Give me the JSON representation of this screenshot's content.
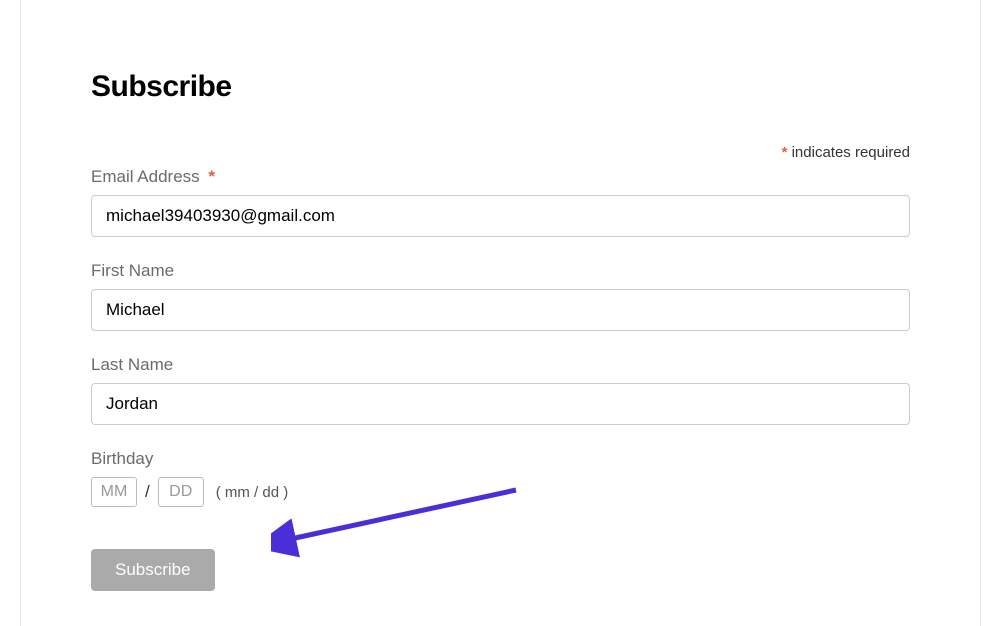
{
  "heading": "Subscribe",
  "requiredNote": {
    "asterisk": "*",
    "text": " indicates required"
  },
  "fields": {
    "email": {
      "label": "Email Address ",
      "asterisk": "*",
      "value": "michael39403930@gmail.com"
    },
    "firstName": {
      "label": "First Name",
      "value": "Michael"
    },
    "lastName": {
      "label": "Last Name",
      "value": "Jordan"
    },
    "birthday": {
      "label": "Birthday",
      "monthPlaceholder": "MM",
      "dayPlaceholder": "DD",
      "slash": "/",
      "hint": "( mm / dd )"
    }
  },
  "submitLabel": "Subscribe"
}
